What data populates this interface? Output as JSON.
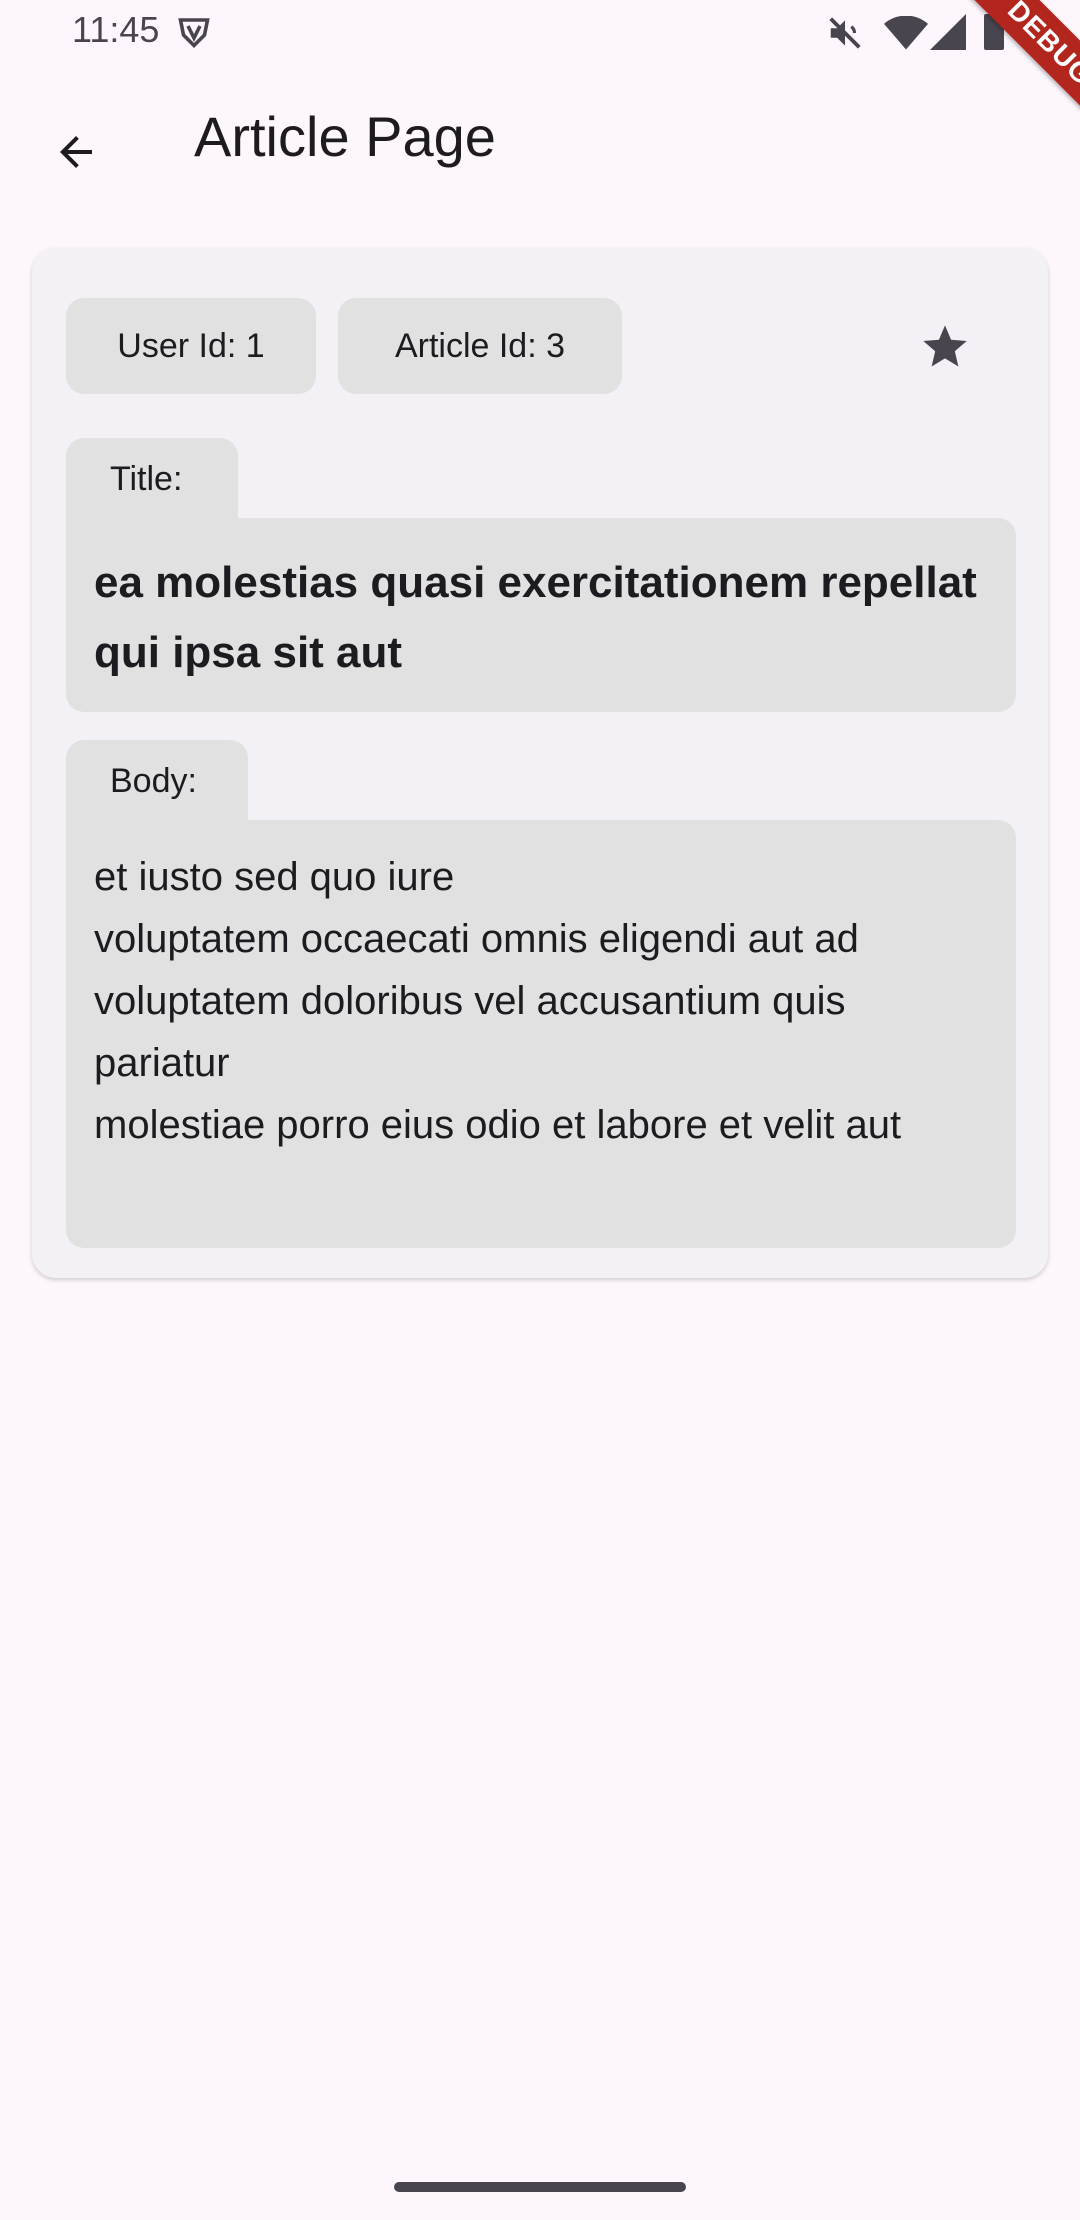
{
  "status_bar": {
    "time": "11:45",
    "icons": [
      "vpn-shield-icon",
      "mute-icon",
      "wifi-icon",
      "signal-icon",
      "battery-icon"
    ]
  },
  "debug_banner": "DEBUG",
  "app_bar": {
    "back_icon": "arrow-back-icon",
    "title": "Article Page"
  },
  "article": {
    "user_chip": "User Id: 1",
    "article_chip": "Article Id: 3",
    "favorite_icon": "star-icon",
    "title_label": "Title:",
    "title": "ea molestias quasi exercitationem repellat qui ipsa sit aut",
    "body_label": "Body:",
    "body": "et iusto sed quo iure\nvoluptatem occaecati omnis eligendi aut ad\nvoluptatem doloribus vel accusantium quis pariatur\nmolestiae porro eius odio et labore et velit aut"
  },
  "colors": {
    "background": "#fdf7fd",
    "card": "#f4f1f6",
    "chip": "#e1e1e1",
    "debug": "#b3261e",
    "text": "#1d1b20"
  }
}
